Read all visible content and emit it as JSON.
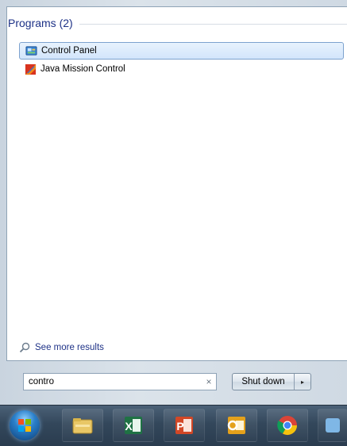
{
  "programs": {
    "header": "Programs (2)",
    "items": [
      {
        "label": "Control Panel",
        "icon": "control-panel-icon",
        "selected": true
      },
      {
        "label": "Java Mission Control",
        "icon": "java-mission-control-icon",
        "selected": false
      }
    ]
  },
  "see_more": {
    "label": "See more results",
    "icon": "magnifier-icon"
  },
  "search": {
    "value": "contro",
    "clear_icon": "×"
  },
  "shutdown": {
    "label": "Shut down",
    "arrow": "▸"
  },
  "taskbar": {
    "items": [
      {
        "name": "start-button",
        "icon": "windows-orb-icon"
      },
      {
        "name": "file-explorer",
        "icon": "folder-icon"
      },
      {
        "name": "excel",
        "icon": "excel-icon"
      },
      {
        "name": "powerpoint",
        "icon": "powerpoint-icon"
      },
      {
        "name": "outlook",
        "icon": "outlook-icon"
      },
      {
        "name": "chrome",
        "icon": "chrome-icon"
      }
    ]
  },
  "colors": {
    "accent_blue": "#1e3287",
    "selection_border": "#7da2ce"
  }
}
